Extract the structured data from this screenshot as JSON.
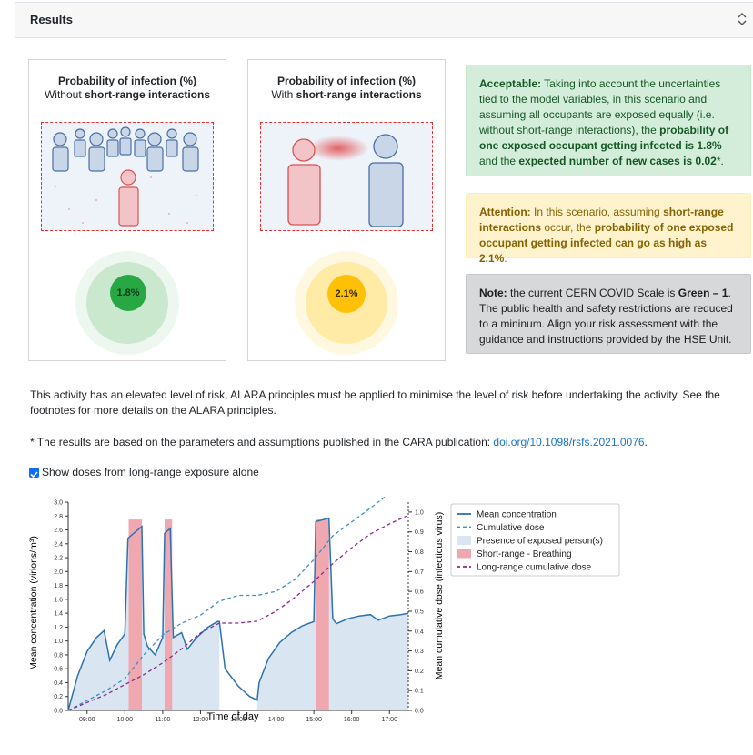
{
  "header": {
    "title": "Results"
  },
  "card_without": {
    "title": "Probability of infection (%)",
    "subtitle_prefix": "Without ",
    "subtitle_bold": "short-range interactions",
    "value": "1.8%",
    "color": "#28a745"
  },
  "card_with": {
    "title": "Probability of infection (%)",
    "subtitle_prefix": "With ",
    "subtitle_bold": "short-range interactions",
    "value": "2.1%",
    "color": "#ffc107"
  },
  "alert_acceptable": {
    "label": "Acceptable:",
    "t1": " Taking into account the uncertainties tied to the model variables, in this scenario and assuming all occupants are exposed equally (i.e. without short-range interactions), the ",
    "b1": "probability of one exposed occupant getting infected is 1.8%",
    "t2": " and the ",
    "b2": "expected number of new cases is 0.02",
    "t3": "*."
  },
  "alert_attention": {
    "label": "Attention:",
    "t1": " In this scenario, assuming ",
    "b1": "short-range interactions",
    "t2": " occur, the ",
    "b2": "probability of one exposed occupant getting infected can go as high as 2.1%",
    "t3": "."
  },
  "alert_note": {
    "label": "Note:",
    "t1": " the current CERN COVID Scale is ",
    "b1": "Green – 1",
    "t2": ". The public health and safety restrictions are reduced to a mininum. Align your risk assessment with the guidance and instructions provided by the HSE Unit."
  },
  "risk_text": "This activity has an elevated level of risk, ALARA principles must be applied to minimise the level of risk before undertaking the activity. See the footnotes for more details on the ALARA principles.",
  "footnote_text": "* The results are based on the parameters and assumptions published in the CARA publication: ",
  "footnote_link": "doi.org/10.1098/rsfs.2021.0076",
  "footnote_end": ".",
  "checkbox_label": "Show doses from long-range exposure alone",
  "chart_data": {
    "type": "line",
    "xlabel": "Time of day",
    "ylabel": "Mean concentration (virions/m³)",
    "y2label": "Mean cumulative dose (infectious virus)",
    "x_ticks": [
      "09:00",
      "10:00",
      "11:00",
      "12:00",
      "13:00",
      "14:00",
      "15:00",
      "16:00",
      "17:00"
    ],
    "xlim": [
      8.5,
      17.5
    ],
    "ylim": [
      0,
      3.0
    ],
    "y2lim": [
      0,
      1.05
    ],
    "y_ticks": [
      0.0,
      0.2,
      0.4,
      0.6,
      0.8,
      1.0,
      1.2,
      1.4,
      1.6,
      1.8,
      2.0,
      2.2,
      2.4,
      2.6,
      2.8,
      3.0
    ],
    "y2_ticks": [
      0.0,
      0.1,
      0.2,
      0.3,
      0.4,
      0.5,
      0.6,
      0.7,
      0.8,
      0.9,
      1.0
    ],
    "legend": [
      "Mean concentration",
      "Cumulative dose",
      "Presence of exposed person(s)",
      "Short-range - Breathing",
      "Long-range cumulative dose"
    ],
    "colors": {
      "concentration": "#2c72b0",
      "cumulative": "#3a8fc4",
      "presence": "#d9e6f2",
      "short_range": "#f0a8b0",
      "long_range": "#8b2a8b"
    },
    "presence_intervals": [
      [
        8.5,
        12.5
      ],
      [
        13.5,
        17.5
      ]
    ],
    "short_range_intervals": [
      [
        10.1,
        10.45
      ],
      [
        11.05,
        11.25
      ],
      [
        15.05,
        15.4
      ]
    ],
    "concentration": [
      [
        8.5,
        0.0
      ],
      [
        8.75,
        0.5
      ],
      [
        9.0,
        0.85
      ],
      [
        9.25,
        1.05
      ],
      [
        9.45,
        1.15
      ],
      [
        9.6,
        0.72
      ],
      [
        9.8,
        0.95
      ],
      [
        10.0,
        1.1
      ],
      [
        10.08,
        2.48
      ],
      [
        10.45,
        2.65
      ],
      [
        10.5,
        1.1
      ],
      [
        10.6,
        0.92
      ],
      [
        10.8,
        0.8
      ],
      [
        11.0,
        1.05
      ],
      [
        11.05,
        2.55
      ],
      [
        11.2,
        2.62
      ],
      [
        11.28,
        1.05
      ],
      [
        11.5,
        1.12
      ],
      [
        11.65,
        0.88
      ],
      [
        11.9,
        1.05
      ],
      [
        12.2,
        1.2
      ],
      [
        12.45,
        1.28
      ],
      [
        12.5,
        1.28
      ],
      [
        12.65,
        0.6
      ],
      [
        13.0,
        0.35
      ],
      [
        13.3,
        0.2
      ],
      [
        13.5,
        0.15
      ],
      [
        13.55,
        0.4
      ],
      [
        13.8,
        0.75
      ],
      [
        14.1,
        0.98
      ],
      [
        14.4,
        1.12
      ],
      [
        14.7,
        1.22
      ],
      [
        15.0,
        1.28
      ],
      [
        15.05,
        2.72
      ],
      [
        15.4,
        2.77
      ],
      [
        15.5,
        1.32
      ],
      [
        15.6,
        1.25
      ],
      [
        15.9,
        1.32
      ],
      [
        16.2,
        1.36
      ],
      [
        16.5,
        1.38
      ],
      [
        16.7,
        1.3
      ],
      [
        17.0,
        1.36
      ],
      [
        17.3,
        1.38
      ],
      [
        17.5,
        1.4
      ]
    ],
    "cumulative_dose": [
      [
        8.5,
        0.0
      ],
      [
        9.0,
        0.05
      ],
      [
        9.5,
        0.1
      ],
      [
        10.0,
        0.16
      ],
      [
        10.5,
        0.28
      ],
      [
        11.0,
        0.38
      ],
      [
        11.5,
        0.44
      ],
      [
        12.0,
        0.48
      ],
      [
        12.5,
        0.55
      ],
      [
        13.0,
        0.58
      ],
      [
        13.5,
        0.58
      ],
      [
        14.0,
        0.6
      ],
      [
        14.5,
        0.66
      ],
      [
        15.0,
        0.76
      ],
      [
        15.5,
        0.88
      ],
      [
        16.0,
        0.95
      ],
      [
        16.5,
        1.02
      ],
      [
        16.9,
        1.08
      ]
    ],
    "long_range_dose": [
      [
        8.5,
        0.0
      ],
      [
        9.0,
        0.04
      ],
      [
        9.5,
        0.08
      ],
      [
        10.0,
        0.13
      ],
      [
        10.5,
        0.18
      ],
      [
        11.0,
        0.24
      ],
      [
        11.5,
        0.31
      ],
      [
        12.0,
        0.39
      ],
      [
        12.5,
        0.44
      ],
      [
        13.0,
        0.44
      ],
      [
        13.5,
        0.45
      ],
      [
        14.0,
        0.5
      ],
      [
        14.5,
        0.57
      ],
      [
        15.0,
        0.65
      ],
      [
        15.5,
        0.74
      ],
      [
        16.0,
        0.82
      ],
      [
        16.5,
        0.89
      ],
      [
        17.0,
        0.94
      ],
      [
        17.45,
        0.98
      ]
    ]
  }
}
